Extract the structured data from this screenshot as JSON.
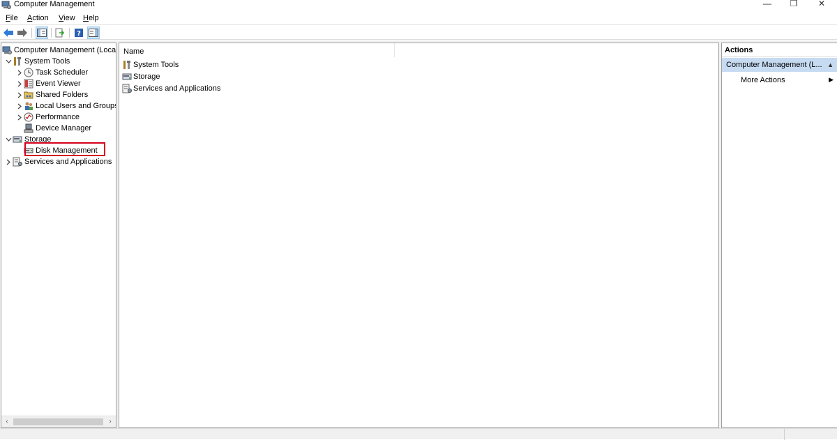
{
  "window": {
    "title": "Computer Management",
    "controls": {
      "minimize": "—",
      "restore": "❐",
      "close": "✕"
    }
  },
  "menubar": {
    "items": [
      {
        "label": "File",
        "access": "F",
        "rest": "ile"
      },
      {
        "label": "Action",
        "access": "A",
        "rest": "ction"
      },
      {
        "label": "View",
        "access": "V",
        "rest": "iew"
      },
      {
        "label": "Help",
        "access": "H",
        "rest": "elp"
      }
    ]
  },
  "toolbar": {
    "buttons": [
      "back-icon",
      "forward-icon",
      "show-hide-console-tree-icon",
      "export-list-icon",
      "help-icon",
      "show-hide-action-pane-icon"
    ]
  },
  "tree": {
    "root": "Computer Management (Local",
    "items": [
      {
        "label": "System Tools",
        "level": 1,
        "expander": "expanded",
        "icon": "tools-icon"
      },
      {
        "label": "Task Scheduler",
        "level": 2,
        "expander": "collapsed",
        "icon": "clock-icon"
      },
      {
        "label": "Event Viewer",
        "level": 2,
        "expander": "collapsed",
        "icon": "event-viewer-icon"
      },
      {
        "label": "Shared Folders",
        "level": 2,
        "expander": "collapsed",
        "icon": "shared-folders-icon"
      },
      {
        "label": "Local Users and Groups",
        "level": 2,
        "expander": "collapsed",
        "icon": "users-icon"
      },
      {
        "label": "Performance",
        "level": 2,
        "expander": "collapsed",
        "icon": "performance-icon"
      },
      {
        "label": "Device Manager",
        "level": 2,
        "expander": "none",
        "icon": "device-manager-icon"
      },
      {
        "label": "Storage",
        "level": 1,
        "expander": "expanded",
        "icon": "storage-icon"
      },
      {
        "label": "Disk Management",
        "level": 2,
        "expander": "none",
        "icon": "disk-icon",
        "highlighted": true
      },
      {
        "label": "Services and Applications",
        "level": 1,
        "expander": "collapsed",
        "icon": "services-icon"
      }
    ]
  },
  "content": {
    "column_header": "Name",
    "rows": [
      {
        "label": "System Tools",
        "icon": "tools-icon"
      },
      {
        "label": "Storage",
        "icon": "storage-icon"
      },
      {
        "label": "Services and Applications",
        "icon": "services-icon"
      }
    ]
  },
  "actions": {
    "title": "Actions",
    "section": "Computer Management (L...",
    "items": [
      {
        "label": "More Actions"
      }
    ]
  },
  "colors": {
    "highlight_border": "#d6001c",
    "action_section_bg": "#c6dbf1",
    "pressed_button_bg": "#cce4f7"
  }
}
